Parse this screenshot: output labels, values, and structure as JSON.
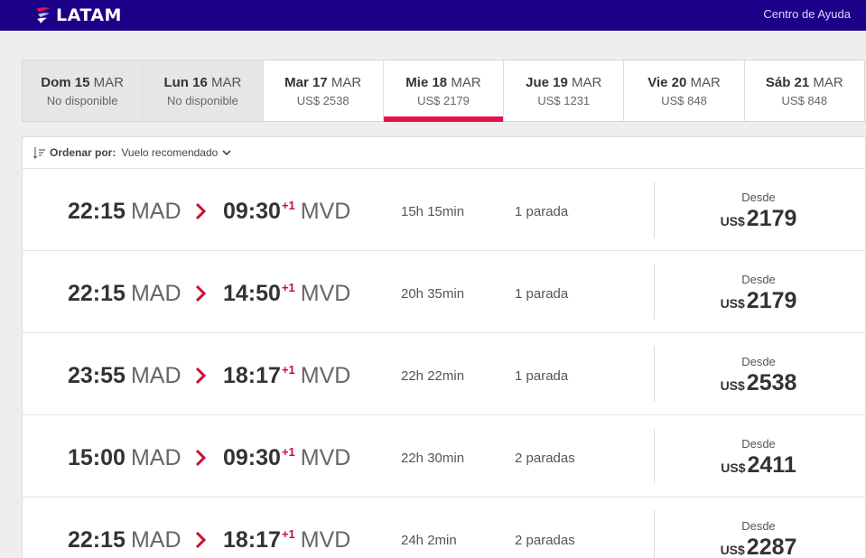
{
  "header": {
    "logo_text": "LATAM",
    "help_link": "Centro de Ayuda"
  },
  "dates": [
    {
      "day": "Dom 15",
      "month": "MAR",
      "sub": "No disponible",
      "available": false,
      "selected": false
    },
    {
      "day": "Lun 16",
      "month": "MAR",
      "sub": "No disponible",
      "available": false,
      "selected": false
    },
    {
      "day": "Mar 17",
      "month": "MAR",
      "sub": "US$ 2538",
      "available": true,
      "selected": false
    },
    {
      "day": "Mie 18",
      "month": "MAR",
      "sub": "US$ 2179",
      "available": true,
      "selected": true
    },
    {
      "day": "Jue 19",
      "month": "MAR",
      "sub": "US$ 1231",
      "available": true,
      "selected": false
    },
    {
      "day": "Vie 20",
      "month": "MAR",
      "sub": "US$ 848",
      "available": true,
      "selected": false
    },
    {
      "day": "Sáb 21",
      "month": "MAR",
      "sub": "US$ 848",
      "available": true,
      "selected": false
    }
  ],
  "sort": {
    "label": "Ordenar por:",
    "value": "Vuelo recomendado"
  },
  "flights": [
    {
      "dep_time": "22:15",
      "dep_code": "MAD",
      "arr_time": "09:30",
      "plus": "+1",
      "arr_code": "MVD",
      "duration": "15h 15min",
      "stops": "1 parada",
      "from_label": "Desde",
      "currency": "US$",
      "price": "2179"
    },
    {
      "dep_time": "22:15",
      "dep_code": "MAD",
      "arr_time": "14:50",
      "plus": "+1",
      "arr_code": "MVD",
      "duration": "20h 35min",
      "stops": "1 parada",
      "from_label": "Desde",
      "currency": "US$",
      "price": "2179"
    },
    {
      "dep_time": "23:55",
      "dep_code": "MAD",
      "arr_time": "18:17",
      "plus": "+1",
      "arr_code": "MVD",
      "duration": "22h 22min",
      "stops": "1 parada",
      "from_label": "Desde",
      "currency": "US$",
      "price": "2538"
    },
    {
      "dep_time": "15:00",
      "dep_code": "MAD",
      "arr_time": "09:30",
      "plus": "+1",
      "arr_code": "MVD",
      "duration": "22h 30min",
      "stops": "2 paradas",
      "from_label": "Desde",
      "currency": "US$",
      "price": "2411"
    },
    {
      "dep_time": "22:15",
      "dep_code": "MAD",
      "arr_time": "18:17",
      "plus": "+1",
      "arr_code": "MVD",
      "duration": "24h 2min",
      "stops": "2 paradas",
      "from_label": "Desde",
      "currency": "US$",
      "price": "2287"
    }
  ],
  "colors": {
    "header_bg": "#1b0088",
    "accent": "#e8114b",
    "next_day": "#c8102e"
  }
}
